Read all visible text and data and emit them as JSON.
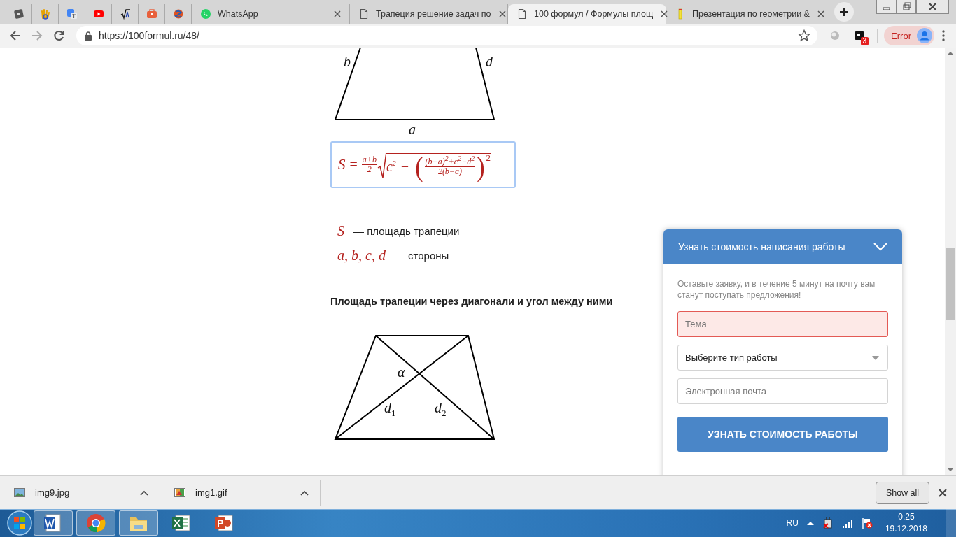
{
  "browser": {
    "pinned_tabs": [
      {
        "selected": false
      },
      {
        "selected": false
      },
      {
        "selected": false
      },
      {
        "selected": false
      },
      {
        "selected": false
      },
      {
        "selected": false
      },
      {
        "selected": false
      }
    ],
    "tabs": [
      {
        "title": "WhatsApp",
        "selected": false
      },
      {
        "title": "Трапеция решение задач по",
        "selected": false
      },
      {
        "title": "100 формул / Формулы площ",
        "selected": true
      },
      {
        "title": "Презентация по геометрии &",
        "selected": false
      }
    ],
    "address": {
      "url": "https://100formul.ru/48/"
    },
    "extension_badge": "3",
    "profile": {
      "status": "Error"
    }
  },
  "article": {
    "figure_1": {
      "labels": [
        "b",
        "d",
        "a"
      ]
    },
    "formula": {
      "lhs": "S",
      "equals": "=",
      "fraction_1": {
        "numerator": "a+b",
        "denominator": "2"
      },
      "term": "c$^{2}$",
      "minus": "−",
      "open_paren": "(",
      "fraction_2": {
        "numerator": "(b−a)$^{2}$+c$^{2}$−d$^{2}$",
        "denominator": "2(b−a)"
      },
      "close_paren": ")",
      "exponent": "2"
    },
    "legend": [
      {
        "symbol": "S",
        "description": "— площадь трапеции"
      },
      {
        "symbol": "a, b, c, d",
        "description": "— стороны"
      }
    ],
    "heading": "Площадь трапеции через диагонали и угол между ними",
    "figure_2": {
      "labels": [
        "α",
        "d$_{1}$",
        "d$_{2}$"
      ]
    }
  },
  "widget": {
    "title": "Узнать стоимость написания работы",
    "note": "Оставьте заявку, и в течение 5 минут на почту вам станут поступать предложения!",
    "fields": [
      {
        "kind": "text",
        "placeholder": "Тема",
        "invalid": true
      },
      {
        "kind": "select",
        "value": "Выберите тип работы",
        "invalid": false
      },
      {
        "kind": "text",
        "placeholder": "Электронная почта",
        "invalid": false
      }
    ],
    "button": "УЗНАТЬ СТОИМОСТЬ РАБОТЫ"
  },
  "downloads": {
    "items": [
      {
        "name": "img9.jpg"
      },
      {
        "name": "img1.gif"
      }
    ],
    "show_all": "Show all"
  },
  "taskbar": {
    "apps": [
      {
        "kind": "word",
        "running": true
      },
      {
        "kind": "chrome",
        "running": true
      },
      {
        "kind": "explorer",
        "running": true
      },
      {
        "kind": "excel",
        "running": false
      },
      {
        "kind": "powerpoint",
        "running": false
      }
    ],
    "tray": {
      "language": "RU",
      "time": "0:25",
      "date": "19.12.2018"
    }
  }
}
